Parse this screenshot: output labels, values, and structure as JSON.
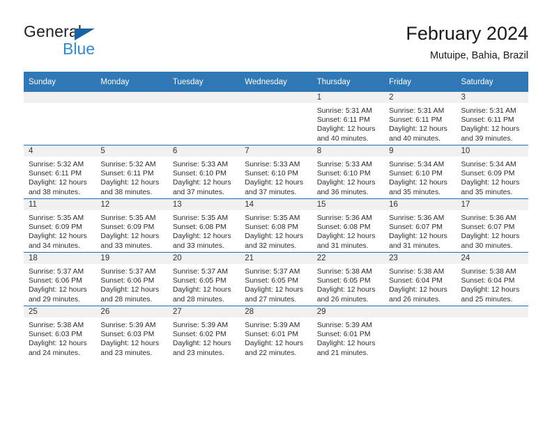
{
  "brand": {
    "name_part1": "General",
    "name_part2": "Blue",
    "triangle_icon": "triangle-icon",
    "accent_dark": "#1464a5",
    "accent_light": "#2e8ad4"
  },
  "header": {
    "month_title": "February 2024",
    "location": "Mutuipe, Bahia, Brazil"
  },
  "theme": {
    "header_blue": "#3077b5",
    "separator_blue": "#1f6db5",
    "daynum_band": "#f0f0f0"
  },
  "weekday_headers": [
    "Sunday",
    "Monday",
    "Tuesday",
    "Wednesday",
    "Thursday",
    "Friday",
    "Saturday"
  ],
  "weeks": [
    [
      {
        "day": "",
        "sunrise": "",
        "sunset": "",
        "daylight_1": "",
        "daylight_2": "",
        "empty": true
      },
      {
        "day": "",
        "sunrise": "",
        "sunset": "",
        "daylight_1": "",
        "daylight_2": "",
        "empty": true
      },
      {
        "day": "",
        "sunrise": "",
        "sunset": "",
        "daylight_1": "",
        "daylight_2": "",
        "empty": true
      },
      {
        "day": "",
        "sunrise": "",
        "sunset": "",
        "daylight_1": "",
        "daylight_2": "",
        "empty": true
      },
      {
        "day": "1",
        "sunrise": "Sunrise: 5:31 AM",
        "sunset": "Sunset: 6:11 PM",
        "daylight_1": "Daylight: 12 hours",
        "daylight_2": "and 40 minutes.",
        "empty": false
      },
      {
        "day": "2",
        "sunrise": "Sunrise: 5:31 AM",
        "sunset": "Sunset: 6:11 PM",
        "daylight_1": "Daylight: 12 hours",
        "daylight_2": "and 40 minutes.",
        "empty": false
      },
      {
        "day": "3",
        "sunrise": "Sunrise: 5:31 AM",
        "sunset": "Sunset: 6:11 PM",
        "daylight_1": "Daylight: 12 hours",
        "daylight_2": "and 39 minutes.",
        "empty": false
      }
    ],
    [
      {
        "day": "4",
        "sunrise": "Sunrise: 5:32 AM",
        "sunset": "Sunset: 6:11 PM",
        "daylight_1": "Daylight: 12 hours",
        "daylight_2": "and 38 minutes.",
        "empty": false
      },
      {
        "day": "5",
        "sunrise": "Sunrise: 5:32 AM",
        "sunset": "Sunset: 6:11 PM",
        "daylight_1": "Daylight: 12 hours",
        "daylight_2": "and 38 minutes.",
        "empty": false
      },
      {
        "day": "6",
        "sunrise": "Sunrise: 5:33 AM",
        "sunset": "Sunset: 6:10 PM",
        "daylight_1": "Daylight: 12 hours",
        "daylight_2": "and 37 minutes.",
        "empty": false
      },
      {
        "day": "7",
        "sunrise": "Sunrise: 5:33 AM",
        "sunset": "Sunset: 6:10 PM",
        "daylight_1": "Daylight: 12 hours",
        "daylight_2": "and 37 minutes.",
        "empty": false
      },
      {
        "day": "8",
        "sunrise": "Sunrise: 5:33 AM",
        "sunset": "Sunset: 6:10 PM",
        "daylight_1": "Daylight: 12 hours",
        "daylight_2": "and 36 minutes.",
        "empty": false
      },
      {
        "day": "9",
        "sunrise": "Sunrise: 5:34 AM",
        "sunset": "Sunset: 6:10 PM",
        "daylight_1": "Daylight: 12 hours",
        "daylight_2": "and 35 minutes.",
        "empty": false
      },
      {
        "day": "10",
        "sunrise": "Sunrise: 5:34 AM",
        "sunset": "Sunset: 6:09 PM",
        "daylight_1": "Daylight: 12 hours",
        "daylight_2": "and 35 minutes.",
        "empty": false
      }
    ],
    [
      {
        "day": "11",
        "sunrise": "Sunrise: 5:35 AM",
        "sunset": "Sunset: 6:09 PM",
        "daylight_1": "Daylight: 12 hours",
        "daylight_2": "and 34 minutes.",
        "empty": false
      },
      {
        "day": "12",
        "sunrise": "Sunrise: 5:35 AM",
        "sunset": "Sunset: 6:09 PM",
        "daylight_1": "Daylight: 12 hours",
        "daylight_2": "and 33 minutes.",
        "empty": false
      },
      {
        "day": "13",
        "sunrise": "Sunrise: 5:35 AM",
        "sunset": "Sunset: 6:08 PM",
        "daylight_1": "Daylight: 12 hours",
        "daylight_2": "and 33 minutes.",
        "empty": false
      },
      {
        "day": "14",
        "sunrise": "Sunrise: 5:35 AM",
        "sunset": "Sunset: 6:08 PM",
        "daylight_1": "Daylight: 12 hours",
        "daylight_2": "and 32 minutes.",
        "empty": false
      },
      {
        "day": "15",
        "sunrise": "Sunrise: 5:36 AM",
        "sunset": "Sunset: 6:08 PM",
        "daylight_1": "Daylight: 12 hours",
        "daylight_2": "and 31 minutes.",
        "empty": false
      },
      {
        "day": "16",
        "sunrise": "Sunrise: 5:36 AM",
        "sunset": "Sunset: 6:07 PM",
        "daylight_1": "Daylight: 12 hours",
        "daylight_2": "and 31 minutes.",
        "empty": false
      },
      {
        "day": "17",
        "sunrise": "Sunrise: 5:36 AM",
        "sunset": "Sunset: 6:07 PM",
        "daylight_1": "Daylight: 12 hours",
        "daylight_2": "and 30 minutes.",
        "empty": false
      }
    ],
    [
      {
        "day": "18",
        "sunrise": "Sunrise: 5:37 AM",
        "sunset": "Sunset: 6:06 PM",
        "daylight_1": "Daylight: 12 hours",
        "daylight_2": "and 29 minutes.",
        "empty": false
      },
      {
        "day": "19",
        "sunrise": "Sunrise: 5:37 AM",
        "sunset": "Sunset: 6:06 PM",
        "daylight_1": "Daylight: 12 hours",
        "daylight_2": "and 28 minutes.",
        "empty": false
      },
      {
        "day": "20",
        "sunrise": "Sunrise: 5:37 AM",
        "sunset": "Sunset: 6:05 PM",
        "daylight_1": "Daylight: 12 hours",
        "daylight_2": "and 28 minutes.",
        "empty": false
      },
      {
        "day": "21",
        "sunrise": "Sunrise: 5:37 AM",
        "sunset": "Sunset: 6:05 PM",
        "daylight_1": "Daylight: 12 hours",
        "daylight_2": "and 27 minutes.",
        "empty": false
      },
      {
        "day": "22",
        "sunrise": "Sunrise: 5:38 AM",
        "sunset": "Sunset: 6:05 PM",
        "daylight_1": "Daylight: 12 hours",
        "daylight_2": "and 26 minutes.",
        "empty": false
      },
      {
        "day": "23",
        "sunrise": "Sunrise: 5:38 AM",
        "sunset": "Sunset: 6:04 PM",
        "daylight_1": "Daylight: 12 hours",
        "daylight_2": "and 26 minutes.",
        "empty": false
      },
      {
        "day": "24",
        "sunrise": "Sunrise: 5:38 AM",
        "sunset": "Sunset: 6:04 PM",
        "daylight_1": "Daylight: 12 hours",
        "daylight_2": "and 25 minutes.",
        "empty": false
      }
    ],
    [
      {
        "day": "25",
        "sunrise": "Sunrise: 5:38 AM",
        "sunset": "Sunset: 6:03 PM",
        "daylight_1": "Daylight: 12 hours",
        "daylight_2": "and 24 minutes.",
        "empty": false
      },
      {
        "day": "26",
        "sunrise": "Sunrise: 5:39 AM",
        "sunset": "Sunset: 6:03 PM",
        "daylight_1": "Daylight: 12 hours",
        "daylight_2": "and 23 minutes.",
        "empty": false
      },
      {
        "day": "27",
        "sunrise": "Sunrise: 5:39 AM",
        "sunset": "Sunset: 6:02 PM",
        "daylight_1": "Daylight: 12 hours",
        "daylight_2": "and 23 minutes.",
        "empty": false
      },
      {
        "day": "28",
        "sunrise": "Sunrise: 5:39 AM",
        "sunset": "Sunset: 6:01 PM",
        "daylight_1": "Daylight: 12 hours",
        "daylight_2": "and 22 minutes.",
        "empty": false
      },
      {
        "day": "29",
        "sunrise": "Sunrise: 5:39 AM",
        "sunset": "Sunset: 6:01 PM",
        "daylight_1": "Daylight: 12 hours",
        "daylight_2": "and 21 minutes.",
        "empty": false
      },
      {
        "day": "",
        "sunrise": "",
        "sunset": "",
        "daylight_1": "",
        "daylight_2": "",
        "empty": true
      },
      {
        "day": "",
        "sunrise": "",
        "sunset": "",
        "daylight_1": "",
        "daylight_2": "",
        "empty": true
      }
    ]
  ]
}
